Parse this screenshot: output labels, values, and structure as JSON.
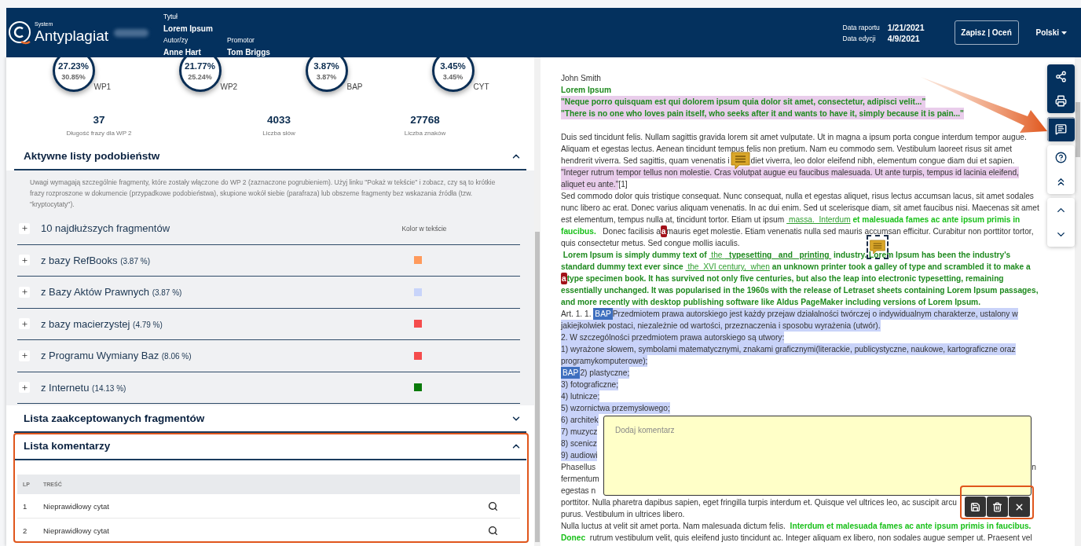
{
  "header": {
    "brand_small": "System",
    "brand": "Antyplagiat",
    "fields": [
      {
        "label": "Tytuł",
        "value": "Lorem Ipsum"
      },
      {
        "label": "Autor/zy",
        "value": "Anne Hart"
      },
      {
        "label": "Promotor",
        "value": "Tom Briggs"
      }
    ],
    "dates": [
      {
        "label": "Data raportu",
        "value": "1/21/2021"
      },
      {
        "label": "Data edycji",
        "value": "4/9/2021"
      }
    ],
    "save_button": "Zapisz | Oceń",
    "language": "Polski"
  },
  "gauges": [
    {
      "value": "27.23%",
      "sub": "30.85%",
      "label": "WP1"
    },
    {
      "value": "21.77%",
      "sub": "25.24%",
      "label": "WP2"
    },
    {
      "value": "3.87%",
      "sub": "3.87%",
      "label": "BAP"
    },
    {
      "value": "3.45%",
      "sub": "3.45%",
      "label": "CYT"
    }
  ],
  "stats": [
    {
      "value": "37",
      "label": "Długość frazy dla WP 2"
    },
    {
      "value": "4033",
      "label": "Liczba słów"
    },
    {
      "value": "27768",
      "label": "Liczba znaków"
    }
  ],
  "active_lists": {
    "title": "Aktywne listy podobieństw",
    "expanded": true,
    "note": "Uwagi wymagają szczególnie fragmenty, które zostały włączone do WP 2 (zaznaczone pogrubieniem). Użyj linku \"Pokaż w tekście\" i zobacz, czy są to krótkie frazy rozproszone w dokumencie (przypadkowe podobieństwa), skupione wokół siebie (parafraza) lub obszerne fragmenty bez wskazania źródła (tzw. \"kryptocytaty\").",
    "top_row": "10 najdłuższych fragmentów",
    "color_header": "Kolor w tekście",
    "sources": [
      {
        "name": "z bazy RefBooks",
        "percent": "(3.87 %)",
        "color": "#ff9a5c"
      },
      {
        "name": "z Bazy Aktów Prawnych",
        "percent": "(3.87 %)",
        "color": "#c8d4fa"
      },
      {
        "name": "z bazy macierzystej",
        "percent": "(4.79 %)",
        "color": "#f54c4c"
      },
      {
        "name": "z Programu Wymiany Baz",
        "percent": "(8.06 %)",
        "color": "#f54c4c"
      },
      {
        "name": "z Internetu",
        "percent": "(14.13 %)",
        "color": "#0a7a0a"
      }
    ]
  },
  "accepted_list": {
    "title": "Lista zaakceptowanych fragmentów",
    "expanded": false
  },
  "comments_list": {
    "title": "Lista komentarzy",
    "expanded": true,
    "columns": [
      "LP",
      "TREŚĆ"
    ],
    "rows": [
      {
        "lp": "1",
        "text": "Nieprawidłowy cytat"
      },
      {
        "lp": "2",
        "text": "Nieprawidłowy cytat"
      }
    ]
  },
  "document": {
    "lines": [
      {
        "segs": [
          {
            "text": "John Smith",
            "kind": "plain"
          }
        ]
      },
      {
        "segs": [
          {
            "text": "Lorem Ipsum",
            "kind": "bold"
          }
        ]
      },
      {
        "segs": [
          {
            "text": "\"Neque porro quisquam est qui dolorem ipsum quia dolor sit amet, consectetur, adipisci velit...\"",
            "kind": "bold",
            "color": "#e9cdeb"
          }
        ]
      },
      {
        "segs": [
          {
            "text": "\"There is no one who loves pain itself, who seeks after it and wants to have it, simply because it is pain...\"",
            "kind": "bold",
            "color": "#e9cdeb"
          }
        ]
      },
      {
        "spaced": true,
        "segs": [
          {
            "text": "Duis sed tincidunt felis. Nullam sagittis gravida lorem sit amet vulputate. Ut in magna a ipsum porta congue interdum tempor augue.",
            "kind": "plain"
          }
        ]
      },
      {
        "segs": [
          {
            "text": "Aliquam et egestas lectus. Aenean tincidunt tempus felis non pretium. Nam eu commodo sem. Vestibulum laoreet risus sit amet",
            "kind": "plain"
          }
        ]
      },
      {
        "segs": [
          {
            "text": "hendrerit viverra. Sed sagittis, quam venenatis i",
            "kind": "plain"
          },
          {
            "kind": "comment"
          },
          {
            "text": "diet viverra, leo dolor eleifend nibh, elementum congue diam dui et sapien.",
            "kind": "plain"
          }
        ]
      },
      {
        "segs": [
          {
            "text": "\"Integer rutrum tempor tellus non molestie. Cras volutpat augue eu faucibus malesuada. Ut ante turpis, tempus id lacinia eleifend,",
            "kind": "plain",
            "color": "#e9cdeb"
          }
        ]
      },
      {
        "segs": [
          {
            "text": "aliquet eu ante.\"",
            "kind": "plain",
            "color": "#e9cdeb"
          },
          {
            "text": "[1]",
            "kind": "plain"
          }
        ]
      },
      {
        "segs": [
          {
            "text": "Sed commodo dolor quis tristique consequat. Nunc consequat, nulla et egestas aliquet, risus lectus accumsan lacus, sit amet sodales",
            "kind": "plain"
          }
        ]
      },
      {
        "segs": [
          {
            "text": "nunc libero ac erat. Donec varius aliquam venenatis. In ac dui enim. Sed ut scelerisque diam, sit amet faucibus nisi. Maecenas sit amet",
            "kind": "plain"
          }
        ]
      },
      {
        "segs": [
          {
            "text": "est elementum, tempus nulla at, tincidunt tortor. Etiam ut ipsum ",
            "kind": "plain"
          },
          {
            "text": " massa.  Interdum",
            "kind": "link"
          },
          {
            "text": " et malesuada fames ac ante ipsum primis in",
            "kind": "bright"
          }
        ]
      },
      {
        "segs": [
          {
            "text": "faucibus.",
            "kind": "bright"
          },
          {
            "text": "   Donec facilisis a",
            "kind": "plain"
          },
          {
            "text": "a",
            "kind": "mark"
          },
          {
            "text": "mauris eget molestie. Etiam venenatis nulla sed mauris accumsan efficitur. Curabitur non porttitor tortor,",
            "kind": "plain"
          }
        ]
      },
      {
        "segs": [
          {
            "text": "quis consectetur metus. Sed congue mollis iaculis.",
            "kind": "plain"
          }
        ]
      },
      {
        "segs": [
          {
            "text": " Lorem Ipsum is simply dummy text of ",
            "kind": "bold"
          },
          {
            "text": " the ",
            "kind": "link"
          },
          {
            "text": "  typesetting   and   printing ",
            "kind": "boldlink"
          },
          {
            "text": " industry. Lorem Ipsum has been the industry's",
            "kind": "bold"
          }
        ]
      },
      {
        "segs": [
          {
            "text": "standard dummy text ever since ",
            "kind": "bold"
          },
          {
            "text": " the  XVI century,  when",
            "kind": "link"
          },
          {
            "text": " an unknown printer took a galley of type and scrambled it to make a",
            "kind": "bold"
          }
        ]
      },
      {
        "segs": [
          {
            "text": "a",
            "kind": "mark"
          },
          {
            "text": "type specimen book. It has survived not only five centuries, but also the leap into electronic typesetting, remaining",
            "kind": "bold"
          }
        ]
      },
      {
        "segs": [
          {
            "text": "essentially unchanged. It was popularised in the 1960s with the release of Letraset sheets containing Lorem Ipsum passages,",
            "kind": "bold"
          }
        ]
      },
      {
        "segs": [
          {
            "text": "and more recently with desktop publishing software like Aldus PageMaker including versions of Lorem Ipsum.",
            "kind": "bold"
          }
        ]
      },
      {
        "segs": [
          {
            "text": "Art. 1. 1. ",
            "kind": "plain"
          },
          {
            "text": "BAP",
            "kind": "tag"
          },
          {
            "text": "Przedmiotem prawa autorskiego jest każdy przejaw działalności twórczej o indywidualnym charakterze, ustalony w",
            "kind": "plain",
            "color": "#c9d3f9"
          }
        ]
      },
      {
        "segs": [
          {
            "text": "jakiejkolwiek postaci, niezależnie od wartości, przeznaczenia i sposobu wyrażenia (utwór).",
            "kind": "plain",
            "color": "#c9d3f9"
          }
        ]
      },
      {
        "segs": [
          {
            "text": "2. W szczególności przedmiotem prawa autorskiego są utwory:",
            "kind": "plain",
            "color": "#c9d3f9"
          }
        ]
      },
      {
        "segs": [
          {
            "text": "1) wyrażone słowem, symbolami matematycznymi, znakami graficznymi(literackie, publicystyczne, naukowe, kartograficzne oraz",
            "kind": "plain",
            "color": "#c9d3f9"
          }
        ]
      },
      {
        "segs": [
          {
            "text": "programykomputerowe);",
            "kind": "plain",
            "color": "#c9d3f9"
          }
        ]
      },
      {
        "segs": [
          {
            "text": "BAP",
            "kind": "tag"
          },
          {
            "text": "2) plastyczne;",
            "kind": "plain",
            "color": "#c9d3f9"
          }
        ]
      },
      {
        "segs": [
          {
            "text": "3) fotograficzne;",
            "kind": "plain",
            "color": "#c9d3f9"
          }
        ]
      },
      {
        "segs": [
          {
            "text": "4) lutnicze;",
            "kind": "plain",
            "color": "#c9d3f9"
          }
        ]
      },
      {
        "segs": [
          {
            "text": "5) wzornictwa przemysłowego;",
            "kind": "plain",
            "color": "#c9d3f9"
          }
        ]
      },
      {
        "segs": [
          {
            "text": "6) architek",
            "kind": "plain",
            "color": "#c9d3f9"
          }
        ]
      },
      {
        "segs": [
          {
            "text": "7) muzycz",
            "kind": "plain",
            "color": "#c9d3f9"
          }
        ]
      },
      {
        "segs": [
          {
            "text": "8) scenicz",
            "kind": "plain",
            "color": "#c9d3f9"
          }
        ]
      },
      {
        "segs": [
          {
            "text": "9) audiowi",
            "kind": "plain",
            "color": "#c9d3f9"
          }
        ]
      },
      {
        "segs": [
          {
            "text": "Phasellus",
            "kind": "plain"
          }
        ],
        "tail": "n"
      },
      {
        "segs": [
          {
            "text": "fermentum",
            "kind": "plain"
          }
        ]
      },
      {
        "segs": [
          {
            "text": "egestas n",
            "kind": "plain"
          }
        ]
      },
      {
        "segs": [
          {
            "text": "porttitor. Nulla pharetra dapibus sapien, eget fringilla turpis interdum et. Quisque vel ultrices leo, ac suscipit arcu",
            "kind": "plain"
          }
        ]
      },
      {
        "segs": [
          {
            "text": "purus. Vestibulum in ultrices libero.",
            "kind": "plain"
          }
        ]
      },
      {
        "segs": [
          {
            "text": "Nulla luctus at velit sit amet porta. Nam malesuada dictum felis.  ",
            "kind": "plain"
          },
          {
            "text": "Interdum et malesuada fames ac ante ipsum primis in faucibus.",
            "kind": "bright"
          }
        ]
      },
      {
        "segs": [
          {
            "text": "Donec",
            "kind": "bright"
          },
          {
            "text": "  rutrum vestibulum velit, quis eleifend justo tincidunt ac. Integer aliquam ex libero, non sodales augue semper ut. Praesent vel",
            "kind": "plain"
          }
        ]
      }
    ]
  },
  "comment_box": {
    "placeholder": "Dodaj komentarz",
    "actions": [
      {
        "kind": "save"
      },
      {
        "kind": "delete"
      },
      {
        "kind": "close"
      }
    ]
  },
  "toolbar": {
    "groups": [
      {
        "kind": "dark",
        "buttons": [
          {
            "kind": "share",
            "selected": false
          },
          {
            "kind": "print",
            "selected": false
          }
        ]
      },
      {
        "kind": "dark",
        "buttons": [
          {
            "kind": "comment",
            "selected": true
          }
        ]
      },
      {
        "kind": "light",
        "buttons": [
          {
            "kind": "help",
            "selected": false
          },
          {
            "kind": "collapse",
            "selected": false
          }
        ]
      },
      {
        "kind": "light",
        "buttons": [
          {
            "kind": "up",
            "selected": false
          },
          {
            "kind": "down",
            "selected": false
          }
        ]
      }
    ]
  }
}
